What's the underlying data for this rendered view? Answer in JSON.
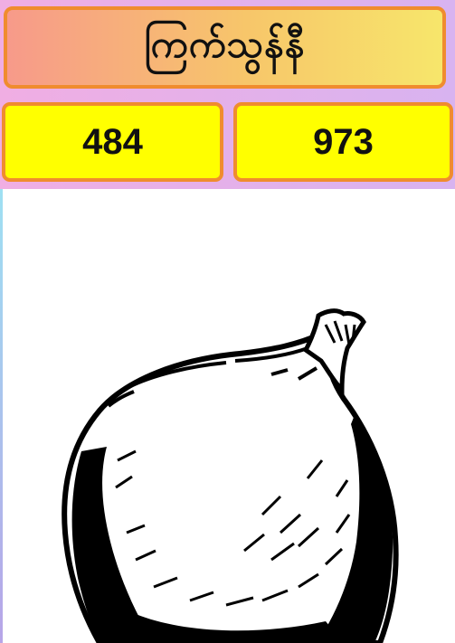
{
  "header": {
    "title": "ကြက်သွန်နီ"
  },
  "scores": {
    "left": "484",
    "right": "973"
  },
  "image": {
    "subject": "onion-illustration"
  },
  "colors": {
    "title_gradient_start": "#f79a8a",
    "title_gradient_end": "#f7e66b",
    "box_border": "#f08c2e",
    "score_bg": "#ffff00",
    "app_bg": "#e7b3e6"
  }
}
